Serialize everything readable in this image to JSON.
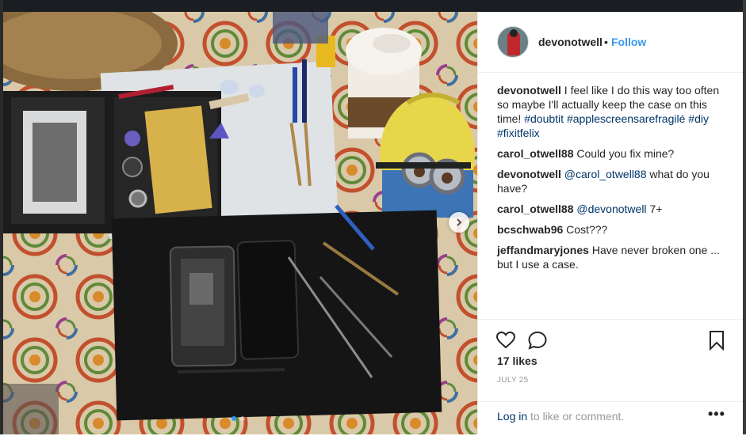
{
  "post": {
    "username": "devonotwell",
    "separator": "•",
    "follow_label": "Follow",
    "caption": {
      "user": "devonotwell",
      "text": "I feel like I do this way too often so maybe I'll actually keep the case on this time!",
      "tags": [
        "#doubtit",
        "#applescreensarefragilé",
        "#diy",
        "#fixitfelix"
      ]
    },
    "comments": [
      {
        "user": "carol_otwell88",
        "mention": "",
        "text": "Could you fix mine?"
      },
      {
        "user": "devonotwell",
        "mention": "@carol_otwell88",
        "text": "what do you have?"
      },
      {
        "user": "carol_otwell88",
        "mention": "@devonotwell",
        "text": "7+"
      },
      {
        "user": "bcschwab96",
        "mention": "",
        "text": "Cost???"
      },
      {
        "user": "jeffandmaryjones",
        "mention": "",
        "text": "Have never broken one ... but I use a case."
      }
    ],
    "likes": "17 likes",
    "date": "JULY 25",
    "login_link": "Log in",
    "login_rest": "to like or comment.",
    "more": "•••"
  },
  "carousel": {
    "slide_count": 2,
    "active_index": 0
  },
  "icons": {
    "heart": "heart-icon",
    "comment": "comment-icon",
    "bookmark": "bookmark-icon",
    "next": "chevron-right-icon"
  },
  "colors": {
    "link_blue": "#3897f0",
    "tag_blue": "#003569",
    "text": "#262626",
    "muted": "#999999"
  }
}
